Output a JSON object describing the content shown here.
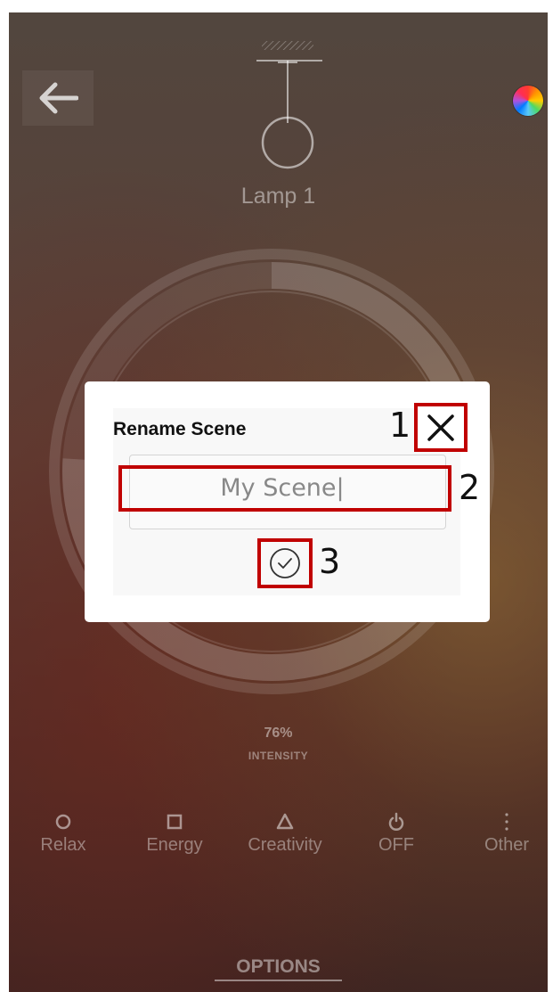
{
  "lamp": {
    "name": "Lamp 1"
  },
  "intensity": {
    "value": "76%",
    "label": "INTENSITY",
    "level": 0.76
  },
  "scenes": [
    {
      "label": "Relax",
      "icon": "circle-icon"
    },
    {
      "label": "Energy",
      "icon": "square-icon"
    },
    {
      "label": "Creativity",
      "icon": "triangle-icon"
    },
    {
      "label": "OFF",
      "icon": "power-icon"
    },
    {
      "label": "Other",
      "icon": "more-vertical-icon"
    }
  ],
  "options_label": "OPTIONS",
  "dialog": {
    "title": "Rename Scene",
    "name_value": "My Scene|",
    "close_icon": "close-icon",
    "confirm_icon": "check-circle-icon"
  },
  "annotations": {
    "one": "1",
    "two": "2",
    "three": "3"
  },
  "colors": {
    "highlight": "#c00000"
  }
}
